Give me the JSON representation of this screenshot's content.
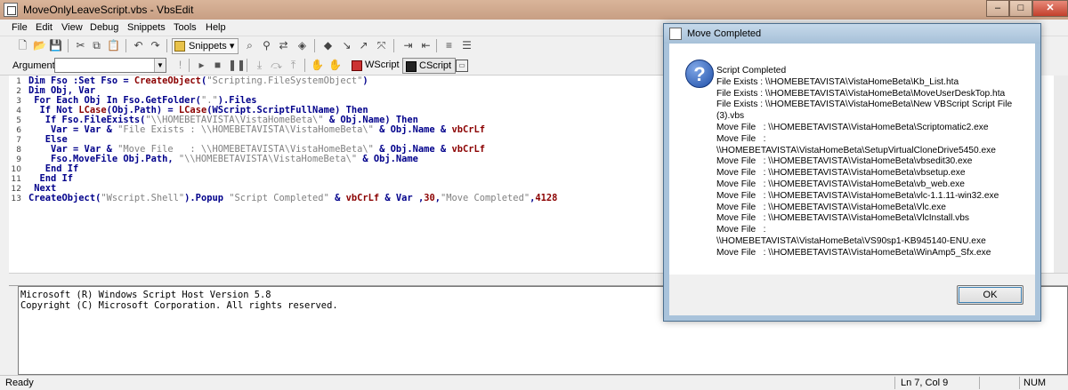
{
  "window": {
    "title": "MoveOnlyLeaveScript.vbs - VbsEdit"
  },
  "menu": [
    "File",
    "Edit",
    "View",
    "Debug",
    "Snippets",
    "Tools",
    "Help"
  ],
  "toolbar": {
    "snippets_label": "Snippets"
  },
  "toolbar2": {
    "arguments_label": "Arguments:",
    "arguments_value": "",
    "wscript_label": "WScript",
    "cscript_label": "CScript"
  },
  "editor": {
    "lines": [
      "1",
      "2",
      "3",
      "4",
      "5",
      "6",
      "7",
      "8",
      "9",
      "10",
      "11",
      "12",
      "13"
    ],
    "code": [
      [
        {
          "t": "Dim Fso :Set Fso = "
        },
        {
          "t": "CreateObject",
          "c": "r"
        },
        {
          "t": "("
        },
        {
          "t": "\"Scripting.FileSystemObject\"",
          "c": "s"
        },
        {
          "t": ")"
        }
      ],
      [
        {
          "t": "Dim Obj, Var"
        }
      ],
      [
        {
          "t": " For Each Obj In Fso.GetFolder("
        },
        {
          "t": "\".\"",
          "c": "s"
        },
        {
          "t": ").Files"
        }
      ],
      [
        {
          "t": "  If Not "
        },
        {
          "t": "LCase",
          "c": "r"
        },
        {
          "t": "(Obj.Path) = "
        },
        {
          "t": "LCase",
          "c": "r"
        },
        {
          "t": "(WScript.ScriptFullName) Then"
        }
      ],
      [
        {
          "t": "   If Fso.FileExists("
        },
        {
          "t": "\"\\\\HOMEBETAVISTA\\VistaHomeBeta\\\"",
          "c": "s"
        },
        {
          "t": " & Obj.Name) Then"
        }
      ],
      [
        {
          "t": "    Var = Var & "
        },
        {
          "t": "\"File Exists : \\\\HOMEBETAVISTA\\VistaHomeBeta\\\"",
          "c": "s"
        },
        {
          "t": " & Obj.Name & "
        },
        {
          "t": "vbCrLf",
          "c": "r"
        }
      ],
      [
        {
          "t": "   Else"
        }
      ],
      [
        {
          "t": "    Var = Var & "
        },
        {
          "t": "\"Move File   : \\\\HOMEBETAVISTA\\VistaHomeBeta\\\"",
          "c": "s"
        },
        {
          "t": " & Obj.Name & "
        },
        {
          "t": "vbCrLf",
          "c": "r"
        }
      ],
      [
        {
          "t": "    Fso.MoveFile Obj.Path, "
        },
        {
          "t": "\"\\\\HOMEBETAVISTA\\VistaHomeBeta\\\"",
          "c": "s"
        },
        {
          "t": " & Obj.Name"
        }
      ],
      [
        {
          "t": "   End If"
        }
      ],
      [
        {
          "t": "  End If"
        }
      ],
      [
        {
          "t": " Next"
        }
      ],
      [
        {
          "t": "CreateObject("
        },
        {
          "t": "\"Wscript.Shell\"",
          "c": "s"
        },
        {
          "t": ").Popup "
        },
        {
          "t": "\"Script Completed\"",
          "c": "s"
        },
        {
          "t": " & "
        },
        {
          "t": "vbCrLf",
          "c": "r"
        },
        {
          "t": " & Var ,"
        },
        {
          "t": "30",
          "c": "r"
        },
        {
          "t": ","
        },
        {
          "t": "\"Move Completed\"",
          "c": "s"
        },
        {
          "t": ","
        },
        {
          "t": "4128",
          "c": "r"
        }
      ]
    ]
  },
  "output": {
    "line1": "Microsoft (R) Windows Script Host Version 5.8",
    "line2": "Copyright (C) Microsoft Corporation. All rights reserved."
  },
  "status": {
    "left": "Ready",
    "position": "Ln 7, Col 9",
    "num": "NUM"
  },
  "dialog": {
    "title": "Move Completed",
    "lines": [
      "Script Completed",
      "File Exists : \\\\HOMEBETAVISTA\\VistaHomeBeta\\Kb_List.hta",
      "File Exists : \\\\HOMEBETAVISTA\\VistaHomeBeta\\MoveUserDeskTop.hta",
      "File Exists : \\\\HOMEBETAVISTA\\VistaHomeBeta\\New VBScript Script File",
      "(3).vbs",
      "Move File   : \\\\HOMEBETAVISTA\\VistaHomeBeta\\Scriptomatic2.exe",
      "Move File   :",
      "\\\\HOMEBETAVISTA\\VistaHomeBeta\\SetupVirtualCloneDrive5450.exe",
      "Move File   : \\\\HOMEBETAVISTA\\VistaHomeBeta\\vbsedit30.exe",
      "Move File   : \\\\HOMEBETAVISTA\\VistaHomeBeta\\vbsetup.exe",
      "Move File   : \\\\HOMEBETAVISTA\\VistaHomeBeta\\vb_web.exe",
      "Move File   : \\\\HOMEBETAVISTA\\VistaHomeBeta\\vlc-1.1.11-win32.exe",
      "Move File   : \\\\HOMEBETAVISTA\\VistaHomeBeta\\Vlc.exe",
      "Move File   : \\\\HOMEBETAVISTA\\VistaHomeBeta\\VlcInstall.vbs",
      "Move File   :",
      "\\\\HOMEBETAVISTA\\VistaHomeBeta\\VS90sp1-KB945140-ENU.exe",
      "Move File   : \\\\HOMEBETAVISTA\\VistaHomeBeta\\WinAmp5_Sfx.exe"
    ],
    "ok_label": "OK"
  },
  "icons": [
    "app-icon",
    "new-icon",
    "open-icon",
    "save-icon",
    "cut-icon",
    "copy-icon",
    "paste-icon",
    "undo-icon",
    "redo-icon",
    "find-icon",
    "question-icon",
    "close-icon",
    "minimize-icon",
    "maximize-icon"
  ]
}
